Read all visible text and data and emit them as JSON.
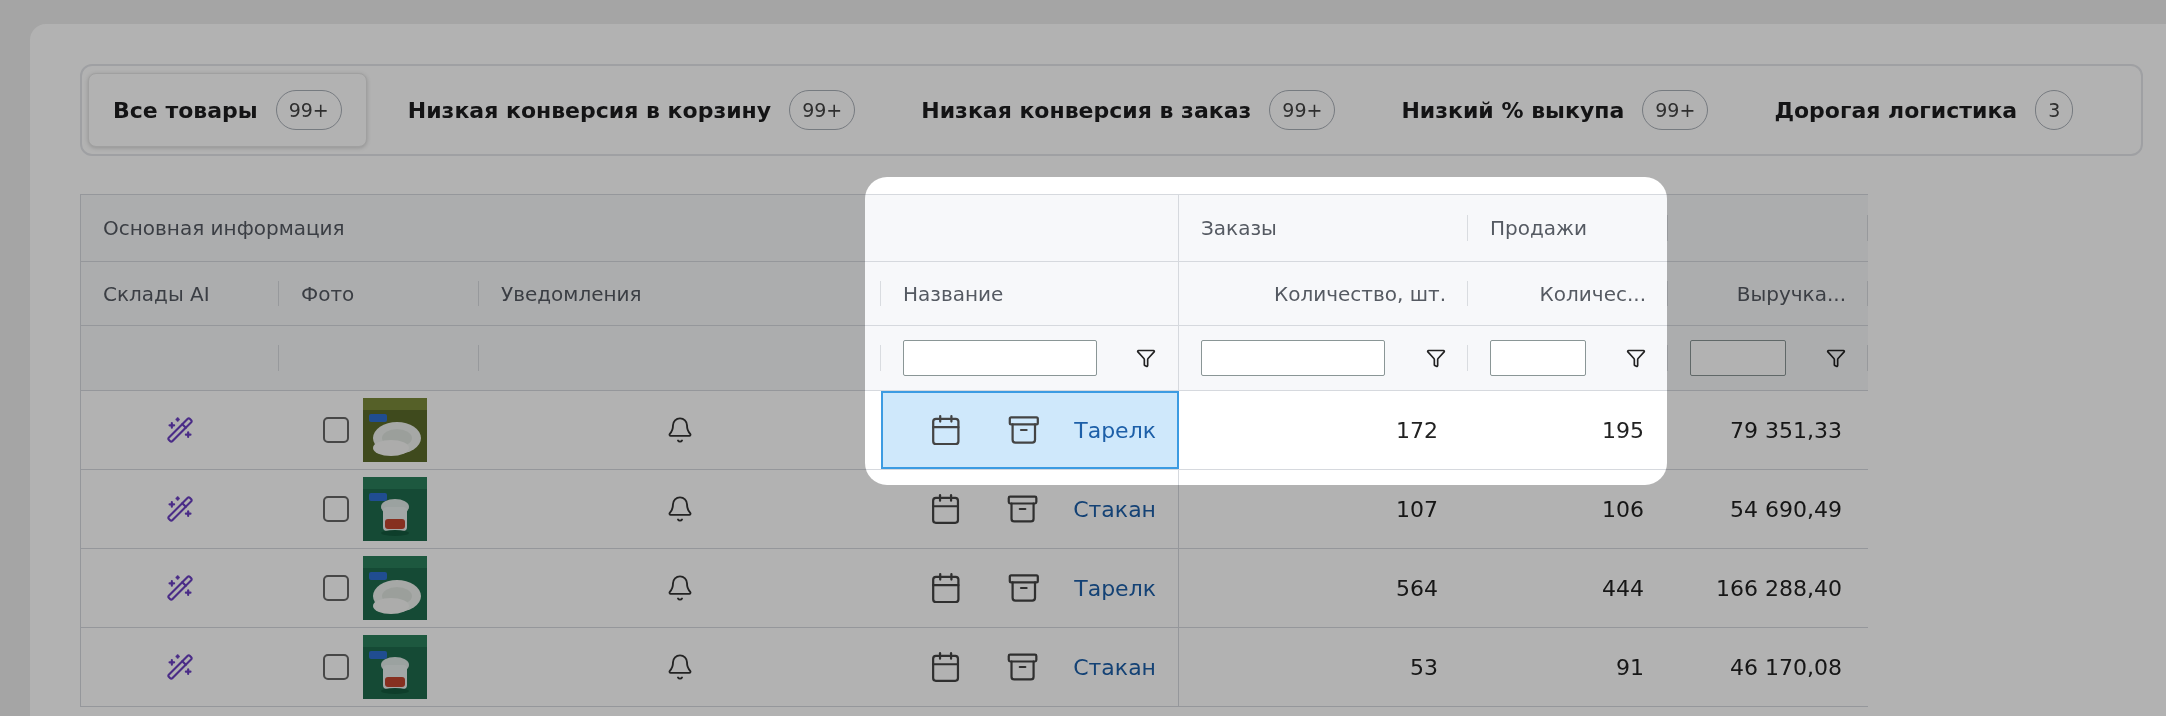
{
  "tabs": [
    {
      "label": "Все товары",
      "count": "99+",
      "selected": true
    },
    {
      "label": "Низкая конверсия в корзину",
      "count": "99+",
      "selected": false
    },
    {
      "label": "Низкая конверсия в заказ",
      "count": "99+",
      "selected": false
    },
    {
      "label": "Низкий % выкупа",
      "count": "99+",
      "selected": false
    },
    {
      "label": "Дорогая логистика",
      "count": "3",
      "selected": false
    }
  ],
  "table": {
    "group_headers": [
      "Основная информация",
      "Заказы",
      "Продажи"
    ],
    "columns": [
      {
        "label": "Склады AI",
        "filter": false
      },
      {
        "label": "Фото",
        "filter": false
      },
      {
        "label": "Уведомления",
        "filter": false
      },
      {
        "label": "Название",
        "filter": true
      },
      {
        "label": "Количество, шт.",
        "filter": true
      },
      {
        "label": "Количес...",
        "filter": true
      },
      {
        "label": "Выручка...",
        "filter": true
      }
    ],
    "rows": [
      {
        "checked": false,
        "name": "Тарелк",
        "selected": true,
        "orders": "172",
        "sales": "195",
        "revenue": "79 351,33"
      },
      {
        "checked": false,
        "name": "Стакан",
        "selected": false,
        "orders": "107",
        "sales": "106",
        "revenue": "54 690,49"
      },
      {
        "checked": false,
        "name": "Тарелк",
        "selected": false,
        "orders": "564",
        "sales": "444",
        "revenue": "166 288,40"
      },
      {
        "checked": false,
        "name": "Стакан",
        "selected": false,
        "orders": "53",
        "sales": "91",
        "revenue": "46 170,08"
      }
    ]
  }
}
